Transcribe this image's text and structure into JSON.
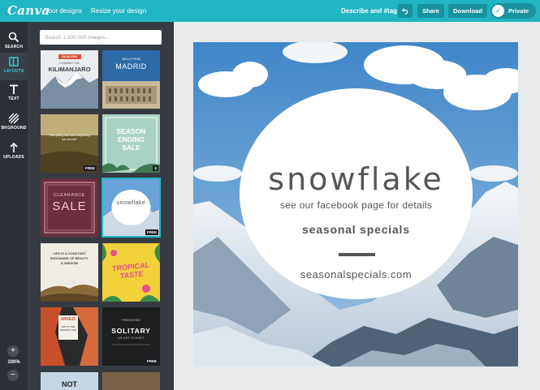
{
  "topbar": {
    "logo": "Canva",
    "nav": [
      "Your designs",
      "Resize your design"
    ],
    "describe": "Describe and #tag",
    "undo_icon": "undo-icon",
    "share": "Share",
    "download": "Download",
    "privacy": "Private"
  },
  "rail": {
    "items": [
      {
        "label": "SEARCH",
        "icon": "search-icon"
      },
      {
        "label": "LAYOUTS",
        "icon": "layouts-icon"
      },
      {
        "label": "TEXT",
        "icon": "text-icon"
      },
      {
        "label": "BKGROUND",
        "icon": "background-icon"
      },
      {
        "label": "UPLOADS",
        "icon": "upload-icon"
      }
    ],
    "zoom": "100%",
    "zoom_in": "+",
    "zoom_out": "−"
  },
  "panel": {
    "search_placeholder": "Search 1,000,000 images...",
    "thumbs": [
      {
        "name": "kilimanjaro",
        "date": "08.28.2016",
        "small": "CLIMBING THE",
        "title": "KILIMANJARO",
        "badge": ""
      },
      {
        "name": "madrid",
        "small": "HELLO FROM",
        "title": "MADRID",
        "badge": ""
      },
      {
        "name": "quote-field",
        "title": "\"Everything that has a beginning has an end\"",
        "badge": "FREE"
      },
      {
        "name": "season-ending-sale",
        "title": "SEASON ENDING SALE",
        "badge": "$"
      },
      {
        "name": "clearance-sale",
        "small": "CLEARANCE",
        "title": "SALE",
        "badge": ""
      },
      {
        "name": "snowflake",
        "title": "snowflake",
        "badge": "FREE"
      },
      {
        "name": "life-is-constant-exchange",
        "title": "LIFE IS A CONSTANT EXCHANGE OF BEAUTY & WISDOM",
        "badge": ""
      },
      {
        "name": "tropical-taste",
        "title": "TROPICAL TASTE",
        "badge": ""
      },
      {
        "name": "mixed-art",
        "title": "MIXED",
        "small": "ART IN THE MODERN AGE",
        "badge": ""
      },
      {
        "name": "solitary",
        "small": "PRESENTING",
        "title": "SOLITARY",
        "sub": "AN ART EXHIBIT",
        "badge": "FREE"
      },
      {
        "name": "not",
        "title": "NOT",
        "badge": ""
      }
    ]
  },
  "design": {
    "title": "snowflake",
    "subtitle": "see our facebook page for details",
    "specials": "seasonal specials",
    "url": "seasonalspecials.com"
  },
  "colors": {
    "accent": "#21b5c2",
    "rail": "#2c3036",
    "panel": "#363b42"
  }
}
